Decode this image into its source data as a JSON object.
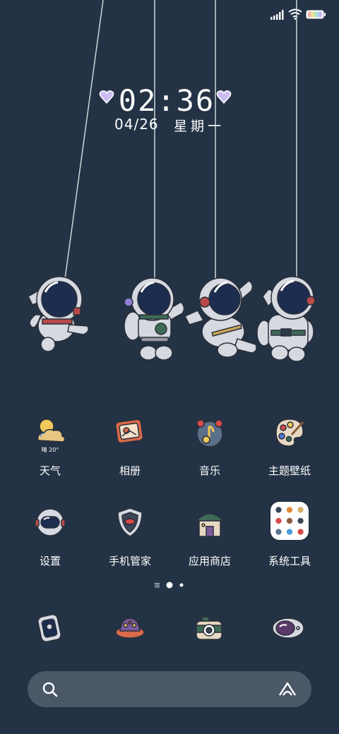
{
  "status_bar": {
    "icons": [
      "signal-icon",
      "wifi-icon",
      "battery-icon"
    ]
  },
  "clock": {
    "time": "02:36",
    "date": "04/26",
    "weekday": "星期一"
  },
  "apps": [
    {
      "label": "天气",
      "icon": "weather-icon",
      "temp": "晴 20°"
    },
    {
      "label": "相册",
      "icon": "gallery-icon"
    },
    {
      "label": "音乐",
      "icon": "music-icon"
    },
    {
      "label": "主题壁纸",
      "icon": "theme-icon"
    },
    {
      "label": "设置",
      "icon": "settings-icon"
    },
    {
      "label": "手机管家",
      "icon": "phone-manager-icon"
    },
    {
      "label": "应用商店",
      "icon": "app-store-icon"
    },
    {
      "label": "系统工具",
      "icon": "system-tools-folder-icon"
    }
  ],
  "dock": [
    "phone-icon",
    "messages-icon",
    "camera-icon",
    "browser-icon"
  ],
  "colors": {
    "background": "#233244",
    "search_bar": "#4a5868",
    "astronaut_suit": "#d6d9e0",
    "visor": "#1d2d4f",
    "accent_red": "#b84a4a",
    "accent_green": "#3e6b57"
  }
}
